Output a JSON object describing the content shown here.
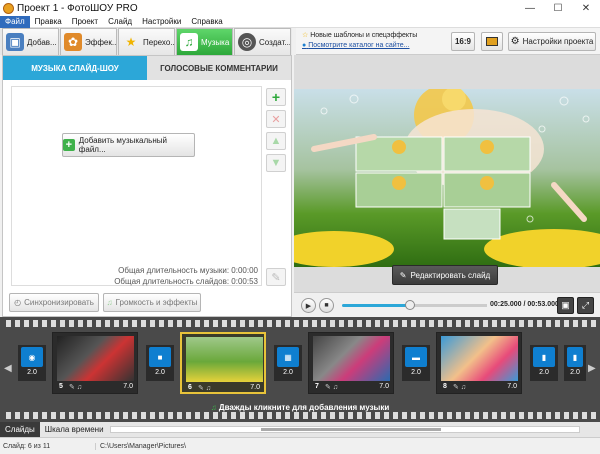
{
  "window": {
    "title": "Проект 1 - ФотоШОУ PRO"
  },
  "menu": [
    "Файл",
    "Правка",
    "Проект",
    "Слайд",
    "Настройки",
    "Справка"
  ],
  "main_tabs": [
    {
      "label": "Добав...",
      "icon": "add-photos-icon"
    },
    {
      "label": "Эффек...",
      "icon": "effects-palette-icon"
    },
    {
      "label": "Перехо...",
      "icon": "transitions-star-icon"
    },
    {
      "label": "Музыка",
      "icon": "music-note-icon"
    },
    {
      "label": "Создат...",
      "icon": "create-disc-icon"
    }
  ],
  "header_right": {
    "news_line1": "Новые шаблоны и спецэффекты",
    "news_line2": "Посмотрите каталог на сайте...",
    "aspect_ratio": "16:9",
    "project_settings": "Настройки проекта"
  },
  "music_panel": {
    "tab_music": "МУЗЫКА СЛАЙД-ШОУ",
    "tab_voice": "ГОЛОСОВЫЕ КОММЕНТАРИИ",
    "add_music": "Добавить музыкальный файл...",
    "total_music": "Общая длительность музыки: 0:00:00",
    "total_slides": "Общая длительность слайдов: 0:00:53",
    "sync_button": "Синхронизировать",
    "volume_button": "Громкость и эффекты"
  },
  "preview": {
    "edit_slide": "Редактировать слайд",
    "timecode": "00:25.000 / 00:53.000",
    "progress": 0.47
  },
  "timeline": {
    "slides": [
      {
        "number": "5",
        "duration": "7.0"
      },
      {
        "number": "6",
        "duration": "7.0"
      },
      {
        "number": "7",
        "duration": "7.0"
      },
      {
        "number": "8",
        "duration": "7.0"
      }
    ],
    "transitions": [
      "2.0",
      "2.0",
      "2.0",
      "2.0",
      "2.0",
      "2.0"
    ],
    "music_hint": "Дважды кликните для добавления музыки"
  },
  "bottom_tabs": [
    "Слайды",
    "Шкала времени"
  ],
  "status": {
    "slide_info": "Слайд: 6 из 11",
    "path": "C:\\Users\\Manager\\Pictures\\"
  }
}
